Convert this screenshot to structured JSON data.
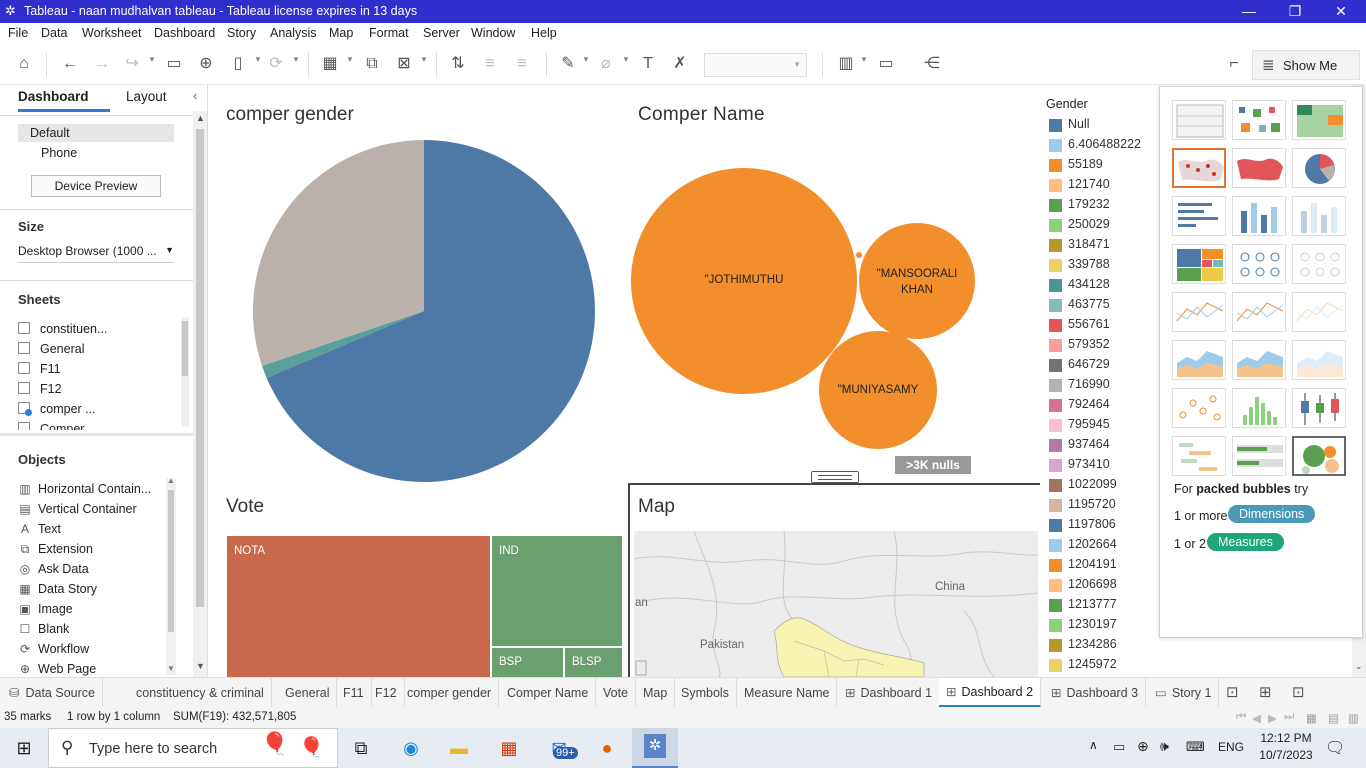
{
  "window": {
    "title": "Tableau - naan mudhalvan tableau - Tableau license expires in 13 days",
    "min": "—",
    "max": "❐",
    "close": "✕"
  },
  "menu": [
    "File",
    "Data",
    "Worksheet",
    "Dashboard",
    "Story",
    "Analysis",
    "Map",
    "Format",
    "Server",
    "Window",
    "Help"
  ],
  "toolbar": {
    "show_me": "Show Me"
  },
  "left": {
    "tab_dashboard": "Dashboard",
    "tab_layout": "Layout",
    "devices": [
      "Default",
      "Phone"
    ],
    "device_preview": "Device Preview",
    "size_title": "Size",
    "size_value": "Desktop Browser (1000 ...",
    "sheets_title": "Sheets",
    "sheets": [
      "constituen...",
      "General",
      "F11",
      "F12",
      "comper ...",
      "Comper..."
    ],
    "objects_title": "Objects",
    "objects": [
      {
        "label": "Horizontal Contain...",
        "icon": "▥"
      },
      {
        "label": "Vertical Container",
        "icon": "▤"
      },
      {
        "label": "Text",
        "icon": "A"
      },
      {
        "label": "Extension",
        "icon": "⧉"
      },
      {
        "label": "Ask Data",
        "icon": "◎"
      },
      {
        "label": "Data Story",
        "icon": "▦"
      },
      {
        "label": "Image",
        "icon": "▣"
      },
      {
        "label": "Blank",
        "icon": "☐"
      },
      {
        "label": "Workflow",
        "icon": "⟳"
      },
      {
        "label": "Web Page",
        "icon": "⊕"
      }
    ]
  },
  "views": {
    "gender_title": "comper gender",
    "name_title": "Comper Name",
    "vote_title": "Vote",
    "map_title": "Map",
    "nulls_badge": ">3K nulls",
    "bubbles": [
      "\"JOTHIMUTHU",
      "\"MANSOORALI KHAN",
      "\"MUNIYASAMY"
    ],
    "treemap": [
      "NOTA",
      "IND",
      "BSP",
      "BLSP"
    ],
    "map_labels": [
      "China",
      "Pakistan",
      "an"
    ]
  },
  "chart_data": [
    {
      "type": "pie",
      "title": "comper gender",
      "slices": [
        {
          "name": "blue",
          "value": 68.6,
          "color": "#4e79a7"
        },
        {
          "name": "teal",
          "value": 1.2,
          "color": "#59a09a"
        },
        {
          "name": "grey",
          "value": 30.2,
          "color": "#bab0ac"
        }
      ]
    },
    {
      "type": "bubble",
      "title": "Comper Name",
      "bubbles": [
        {
          "label": "\"JOTHIMUTHU",
          "color": "#f28e2b"
        },
        {
          "label": "\"MANSOORALI KHAN",
          "color": "#f28e2b"
        },
        {
          "label": "\"MUNIYASAMY",
          "color": "#f28e2b"
        }
      ]
    },
    {
      "type": "treemap",
      "title": "Vote",
      "items": [
        {
          "label": "NOTA",
          "color": "#c8694d"
        },
        {
          "label": "IND",
          "color": "#6a9f6e"
        },
        {
          "label": "BSP",
          "color": "#6a9f6e"
        },
        {
          "label": "BLSP",
          "color": "#6a9f6e"
        }
      ]
    }
  ],
  "legend": {
    "title": "Gender",
    "items": [
      {
        "label": "Null",
        "color": "#4e79a7"
      },
      {
        "label": "6.406488222",
        "color": "#a0cbe8"
      },
      {
        "label": "55189",
        "color": "#f28e2b"
      },
      {
        "label": "121740",
        "color": "#ffbe7d"
      },
      {
        "label": "179232",
        "color": "#59a14f"
      },
      {
        "label": "250029",
        "color": "#8cd17d"
      },
      {
        "label": "318471",
        "color": "#b6992d"
      },
      {
        "label": "339788",
        "color": "#f1ce63"
      },
      {
        "label": "434128",
        "color": "#499894"
      },
      {
        "label": "463775",
        "color": "#86bcb6"
      },
      {
        "label": "556761",
        "color": "#e15759"
      },
      {
        "label": "579352",
        "color": "#ff9d9a"
      },
      {
        "label": "646729",
        "color": "#79706e"
      },
      {
        "label": "716990",
        "color": "#bab0ac"
      },
      {
        "label": "792464",
        "color": "#d37295"
      },
      {
        "label": "795945",
        "color": "#fabfd2"
      },
      {
        "label": "937464",
        "color": "#b07aa1"
      },
      {
        "label": "973410",
        "color": "#d4a6c8"
      },
      {
        "label": "1022099",
        "color": "#9d7660"
      },
      {
        "label": "1195720",
        "color": "#d7b5a6"
      },
      {
        "label": "1197806",
        "color": "#4e79a7"
      },
      {
        "label": "1202664",
        "color": "#a0cbe8"
      },
      {
        "label": "1204191",
        "color": "#f28e2b"
      },
      {
        "label": "1206698",
        "color": "#ffbe7d"
      },
      {
        "label": "1213777",
        "color": "#59a14f"
      },
      {
        "label": "1230197",
        "color": "#8cd17d"
      },
      {
        "label": "1234286",
        "color": "#b6992d"
      },
      {
        "label": "1245972",
        "color": "#f1ce63"
      }
    ]
  },
  "showme": {
    "hint_prefix": "For ",
    "hint_bold": "packed bubbles",
    "hint_suffix": " try",
    "dim_prefix": "1 or more",
    "dim_label": "Dimensions",
    "meas_prefix": "1 or 2",
    "meas_label": "Measures"
  },
  "tabs": [
    "Data Source",
    "constituency & criminal",
    "General",
    "F11",
    "F12",
    "comper gender",
    "Comper Name",
    "Vote",
    "Map",
    "Symbols",
    "Measure Name",
    "Dashboard 1",
    "Dashboard 2",
    "Dashboard 3",
    "Story 1"
  ],
  "active_tab": "Dashboard 2",
  "status": {
    "marks": "35 marks",
    "rows": "1 row by 1 column",
    "sum": "SUM(F19): 432,571,805"
  },
  "taskbar": {
    "search_placeholder": "Type here to search",
    "time": "12:12 PM",
    "date": "10/7/2023",
    "lang": "ENG",
    "mail_badge": "99+"
  }
}
